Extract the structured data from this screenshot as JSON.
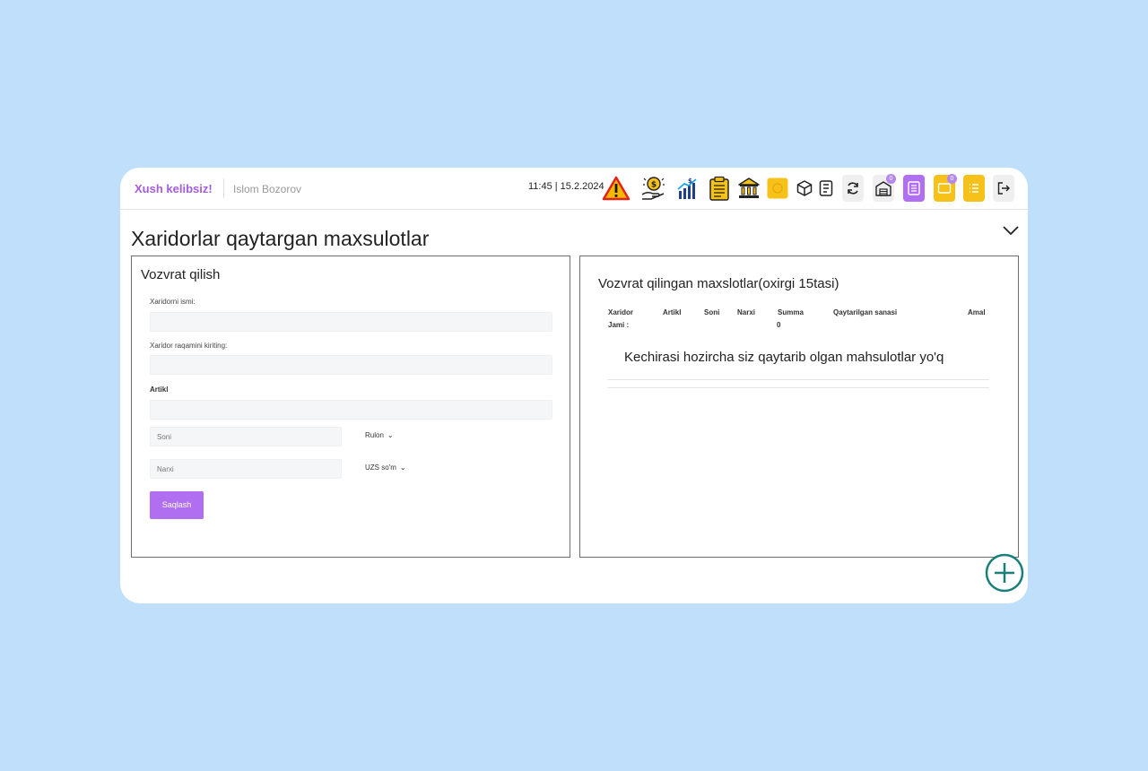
{
  "header": {
    "welcome": "Xush kelibsiz!",
    "user_name": "Islom Bozorov",
    "datetime": "11:45 | 15.2.2024",
    "toolbar_icons": [
      "warning-icon",
      "money-hand-icon",
      "finance-chart-icon",
      "clipboard-icon",
      "bank-icon",
      "box-yellow-icon",
      "cube-icon",
      "receipt-icon",
      "refresh-icon",
      "warehouse-icon",
      "calculator-icon",
      "folder-icon",
      "list-icon",
      "logout-icon"
    ],
    "badges": {
      "warehouse": "0",
      "folder": "0"
    }
  },
  "page": {
    "title": "Xaridorlar qaytargan maxsulotlar"
  },
  "form": {
    "title": "Vozvrat qilish",
    "customer_name_label": "Xaridorni ismi:",
    "customer_phone_label": "Xaridor raqamini kiriting:",
    "article_label": "Artikl",
    "quantity_placeholder": "Soni",
    "unit_select": "Rulon",
    "price_placeholder": "Narxi",
    "currency_select": "UZS so'm",
    "save_label": "Saqlash"
  },
  "returns": {
    "title": "Vozvrat qilingan maxslotlar(oxirgi 15tasi)",
    "columns": [
      "Xaridor",
      "Artikl",
      "Soni",
      "Narxi",
      "Summa",
      "Qaytarilgan sanasi",
      "Amal"
    ],
    "total_label": "Jami :",
    "total_value": "0",
    "empty_message": "Kechirasi hozircha siz qaytarib olgan mahsulotlar yo'q"
  },
  "colors": {
    "background": "#bfdffb",
    "accent_purple": "#b06ef0",
    "welcome_purple": "#a45ce0",
    "icon_yellow": "#f6c21a",
    "add_button_teal": "#1a7f7a"
  }
}
